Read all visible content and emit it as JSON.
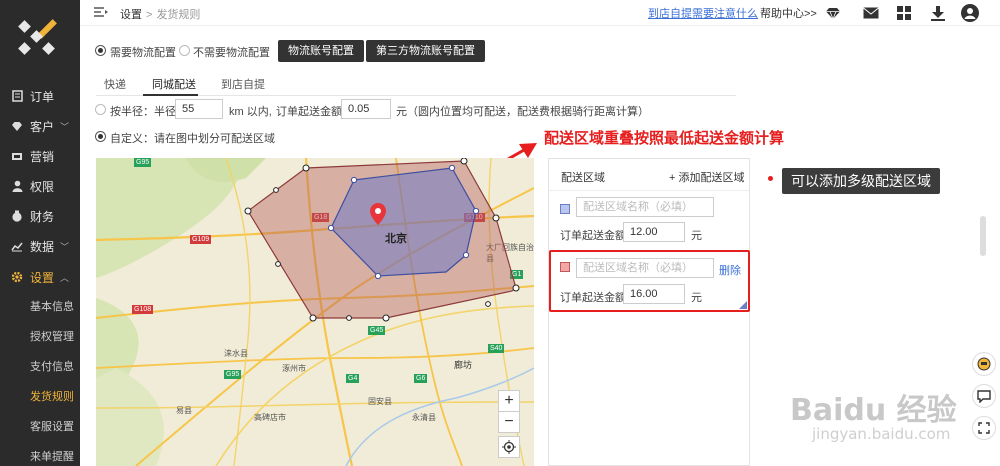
{
  "sidebar": {
    "nav": [
      {
        "label": "订单",
        "icon": "clipboard-icon"
      },
      {
        "label": "客户",
        "icon": "diamond-icon",
        "chevron": "﹀"
      },
      {
        "label": "营销",
        "icon": "megaphone-icon"
      },
      {
        "label": "权限",
        "icon": "person-icon"
      },
      {
        "label": "财务",
        "icon": "money-bag-icon"
      },
      {
        "label": "数据",
        "icon": "chart-icon",
        "chevron": "﹀"
      },
      {
        "label": "设置",
        "icon": "gear-icon",
        "chevron": "︿"
      }
    ],
    "sub": [
      "基本信息",
      "授权管理",
      "支付信息",
      "发货规则",
      "客服设置",
      "来单提醒"
    ],
    "active_color": "#f0b43a"
  },
  "topbar": {
    "breadcrumb_root": "设置",
    "breadcrumb_sep": ">",
    "breadcrumb_current": "发货规则",
    "link": "到店自提需要注意什么",
    "help": "帮助中心>>"
  },
  "shipping": {
    "need_label": "需要物流配置",
    "noneed_label": "不需要物流配置",
    "btn_account": "物流账号配置",
    "btn_third": "第三方物流账号配置"
  },
  "tabs": [
    "快递",
    "同城配送",
    "到店自提"
  ],
  "radius_row": {
    "prefix": "按半径：半径",
    "radius_value": "55",
    "unit": "km 以内,",
    "min_label": "订单起送金额",
    "min_value": "0.05",
    "suffix": "元（圆内位置均可配送，配送费根据骑行距离计算）"
  },
  "custom_row": {
    "label": "自定义：请在图中划分可配送区域"
  },
  "annotation": "配送区域重叠按照最低起送金额计算",
  "panel": {
    "title": "配送区域",
    "add": "+ 添加配送区域",
    "zones": [
      {
        "placeholder": "配送区域名称（必填）",
        "min_label": "订单起送金额",
        "value": "12.00",
        "unit": "元",
        "color": "#b9c6ee"
      },
      {
        "placeholder": "配送区域名称（必填）",
        "min_label": "订单起送金额",
        "value": "16.00",
        "unit": "元",
        "delete": "删除",
        "color": "#f2a7a7"
      }
    ]
  },
  "tooltip": "可以添加多级配送区域",
  "map": {
    "city": "北京",
    "roads": [
      "G95",
      "G6",
      "G110",
      "G109",
      "G108",
      "G4",
      "G45",
      "G95",
      "G1",
      "S40",
      "G18"
    ],
    "towns": [
      "廊坊",
      "大厂回族自治县",
      "涿州市",
      "固安县",
      "永清县",
      "高碑店市",
      "易县",
      "涞水县"
    ],
    "zoom_in": "+",
    "zoom_out": "−"
  },
  "watermark": "Baidu 经验",
  "watermark_url": "jingyan.baidu.com"
}
